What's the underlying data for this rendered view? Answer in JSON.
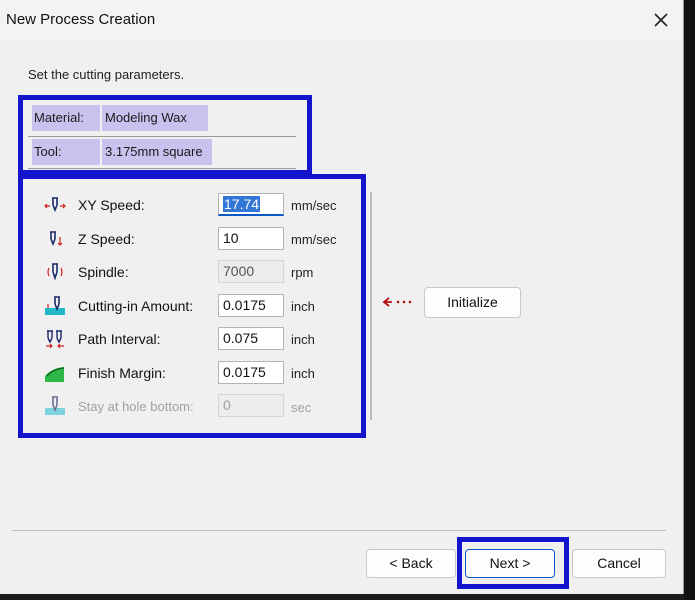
{
  "window": {
    "title": "New Process Creation"
  },
  "instruction": "Set the cutting parameters.",
  "material": {
    "label": "Material:",
    "value": "Modeling Wax"
  },
  "tool": {
    "label": "Tool:",
    "value": "3.175mm square"
  },
  "params": [
    {
      "label": "XY Speed:",
      "value": "17.74",
      "unit": "mm/sec",
      "icon": "xy-speed-icon"
    },
    {
      "label": "Z Speed:",
      "value": "10",
      "unit": "mm/sec",
      "icon": "z-speed-icon"
    },
    {
      "label": "Spindle:",
      "value": "7000",
      "unit": "rpm",
      "icon": "spindle-icon"
    },
    {
      "label": "Cutting-in Amount:",
      "value": "0.0175",
      "unit": "inch",
      "icon": "cutting-in-icon"
    },
    {
      "label": "Path Interval:",
      "value": "0.075",
      "unit": "inch",
      "icon": "path-interval-icon"
    },
    {
      "label": "Finish Margin:",
      "value": "0.0175",
      "unit": "inch",
      "icon": "finish-margin-icon"
    },
    {
      "label": "Stay at hole bottom:",
      "value": "0",
      "unit": "sec",
      "icon": "stay-hole-icon"
    }
  ],
  "buttons": {
    "initialize": "Initialize",
    "back": "< Back",
    "next": "Next >",
    "cancel": "Cancel"
  },
  "colors": {
    "highlight": "#1414cc",
    "field_highlight": "#c7c3ee",
    "selection": "#3276d6"
  }
}
